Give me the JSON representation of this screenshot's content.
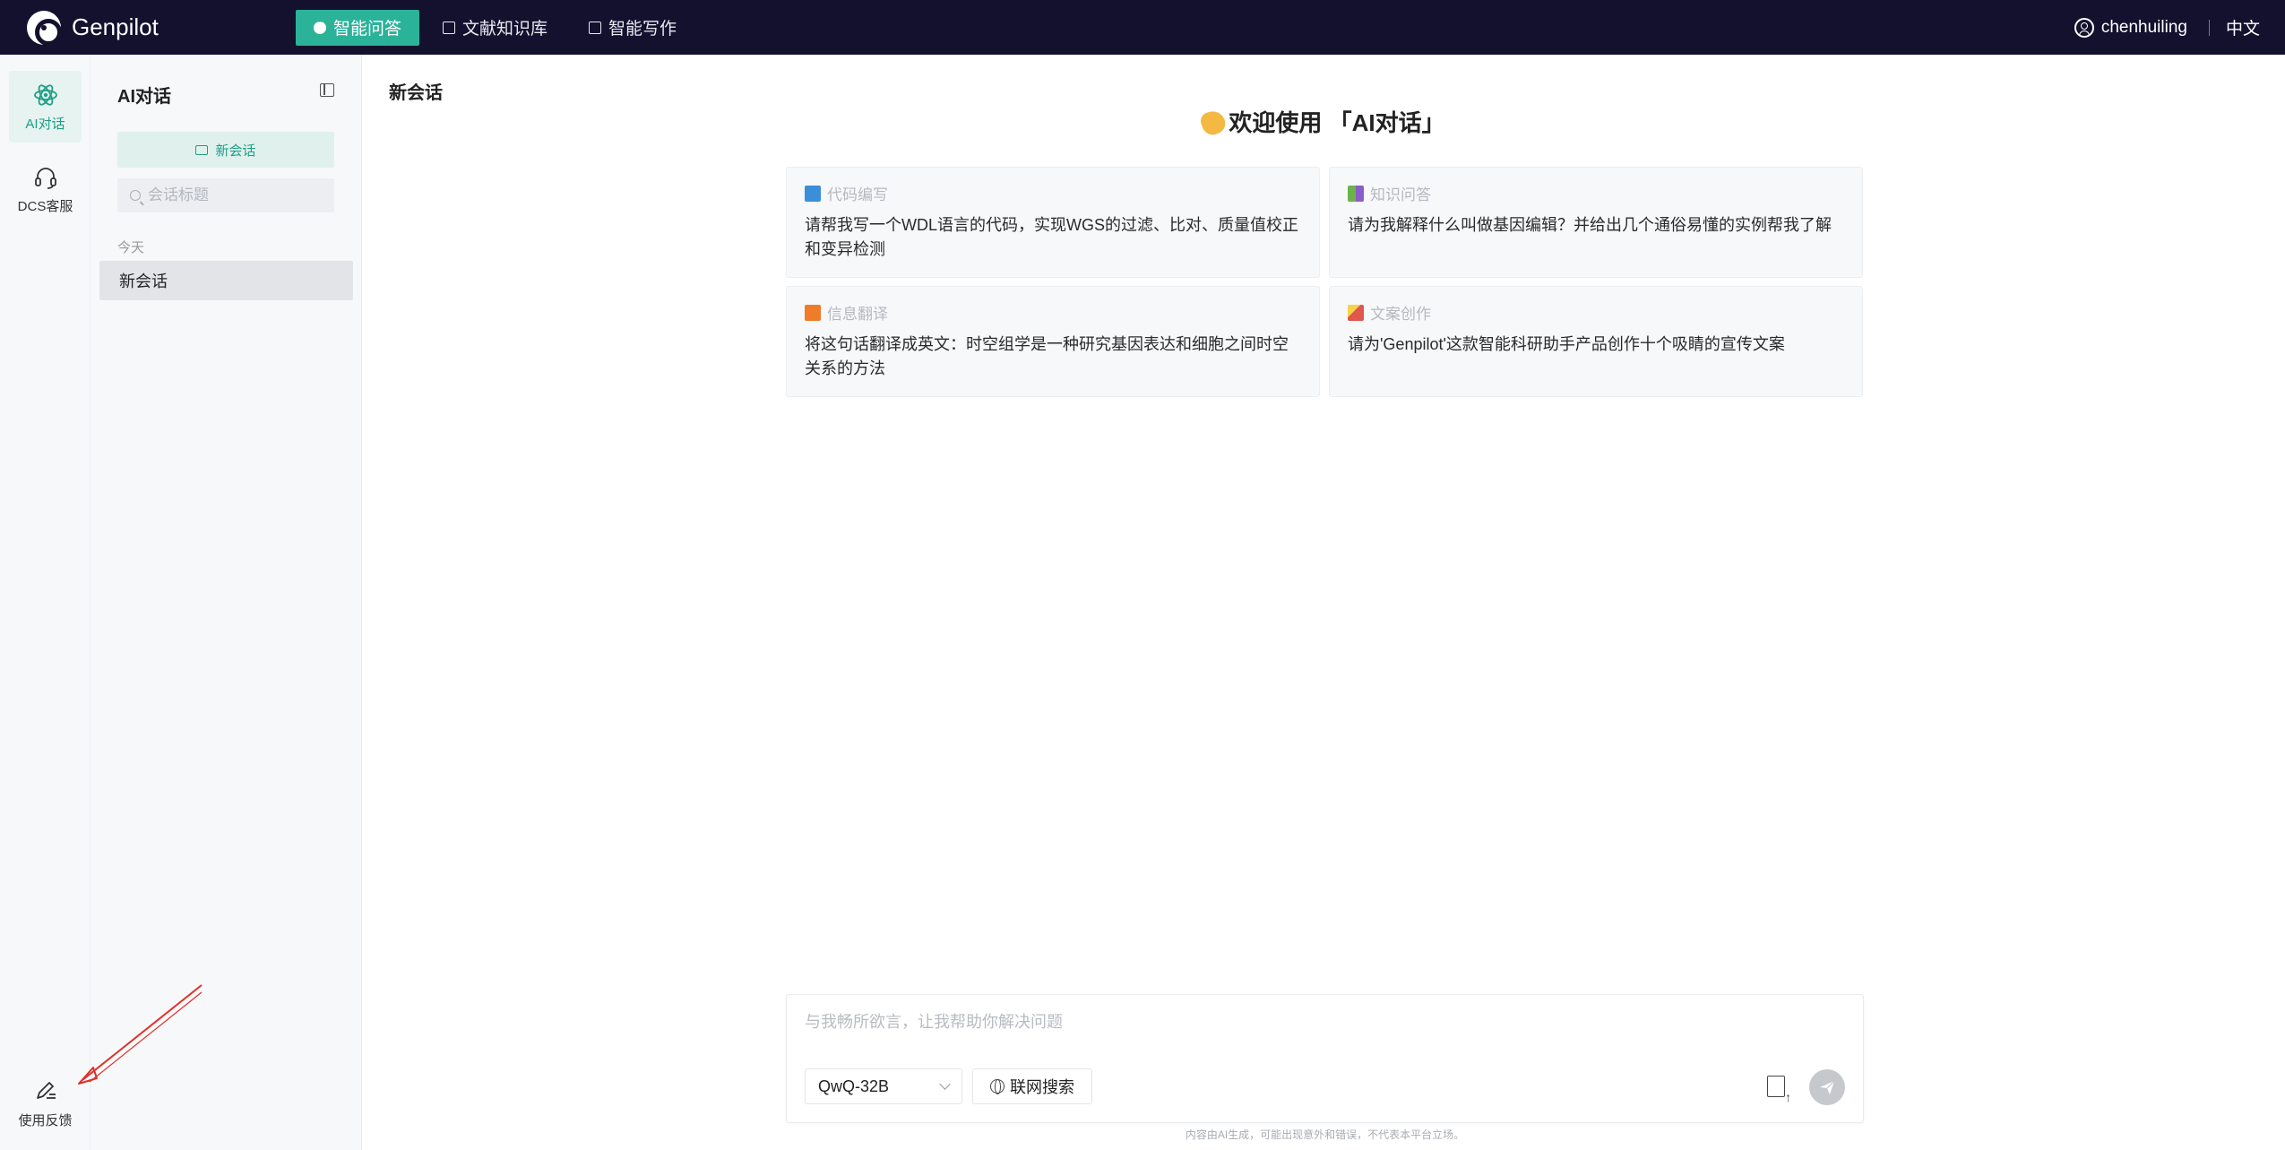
{
  "brand": {
    "name": "Genpilot"
  },
  "nav": [
    {
      "label": "智能问答",
      "active": true
    },
    {
      "label": "文献知识库",
      "active": false
    },
    {
      "label": "智能写作",
      "active": false
    }
  ],
  "user": {
    "name": "chenhuiling",
    "language": "中文"
  },
  "rail": {
    "items": [
      {
        "label": "AI对话",
        "icon": "atom-icon",
        "active": true
      },
      {
        "label": "DCS客服",
        "icon": "headset-icon",
        "active": false
      }
    ],
    "feedback_label": "使用反馈"
  },
  "sidebar": {
    "title": "AI对话",
    "new_chat_label": "新会话",
    "search_placeholder": "会话标题",
    "group_label": "今天",
    "conversations": [
      {
        "title": "新会话"
      }
    ]
  },
  "main": {
    "title": "新会话",
    "welcome": "欢迎使用 「AI对话」",
    "cards": [
      {
        "category": "代码编写",
        "icon": "book-icon",
        "icon_color": "#3b8fd9",
        "text": "请帮我写一个WDL语言的代码，实现WGS的过滤、比对、质量值校正和变异检测"
      },
      {
        "category": "知识问答",
        "icon": "books-icon",
        "icon_color": "#6bb34a",
        "text": "请为我解释什么叫做基因编辑？并给出几个通俗易懂的实例帮我了解"
      },
      {
        "category": "信息翻译",
        "icon": "translate-icon",
        "icon_color": "#f07c2a",
        "text": "将这句话翻译成英文：时空组学是一种研究基因表达和细胞之间时空关系的方法"
      },
      {
        "category": "文案创作",
        "icon": "pen-icon",
        "icon_color": "#e0574e",
        "text": "请为'Genpilot'这款智能科研助手产品创作十个吸睛的宣传文案"
      }
    ]
  },
  "composer": {
    "placeholder": "与我畅所欲言，让我帮助你解决问题",
    "model": "QwQ-32B",
    "web_search_label": "联网搜索",
    "disclaimer": "内容由AI生成，可能出现意外和错误，不代表本平台立场。"
  },
  "colors": {
    "topbar": "#13112e",
    "accent": "#2bb39a",
    "annotation": "#e0302a"
  }
}
